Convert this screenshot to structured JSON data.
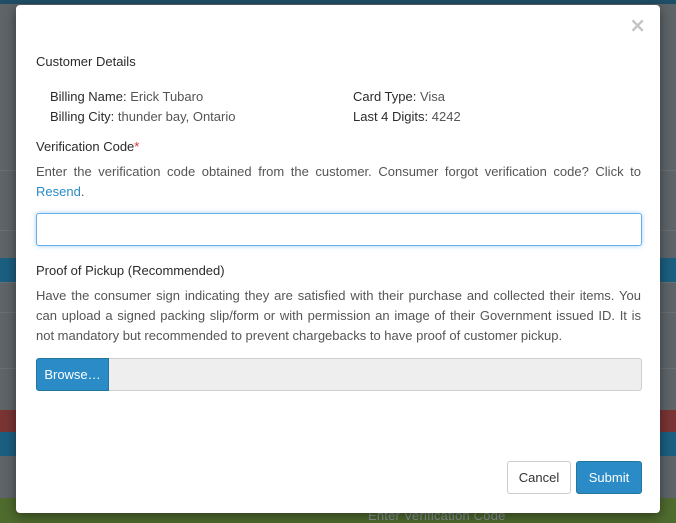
{
  "background": {
    "input_placeholder": "Enter Verification Code"
  },
  "modal": {
    "close_symbol": "×",
    "customer_details": {
      "title": "Customer Details",
      "billing_name_label": "Billing Name:",
      "billing_name_value": "Erick Tubaro",
      "billing_city_label": "Billing City:",
      "billing_city_value": "thunder bay, Ontario",
      "card_type_label": "Card Type:",
      "card_type_value": "Visa",
      "last4_label": "Last 4 Digits:",
      "last4_value": "4242"
    },
    "verification": {
      "title": "Verification Code",
      "required_mark": "*",
      "description": "Enter the verification code obtained from the customer. Consumer forgot verification code? Click to",
      "resend_link": "Resend",
      "resend_suffix": ".",
      "input_value": ""
    },
    "proof": {
      "title": "Proof of Pickup (Recommended)",
      "description": "Have the consumer sign indicating they are satisfied with their purchase and collected their items. You can upload a signed packing slip/form or with permission an image of their Government issued ID. It is not mandatory but recommended to prevent chargebacks to have proof of customer pickup.",
      "browse_label": "Browse…",
      "file_name": ""
    },
    "footer": {
      "cancel_label": "Cancel",
      "submit_label": "Submit"
    }
  },
  "colors": {
    "primary": "#2a8bc6",
    "required": "#d9302c",
    "overlay": "#5e6468"
  }
}
